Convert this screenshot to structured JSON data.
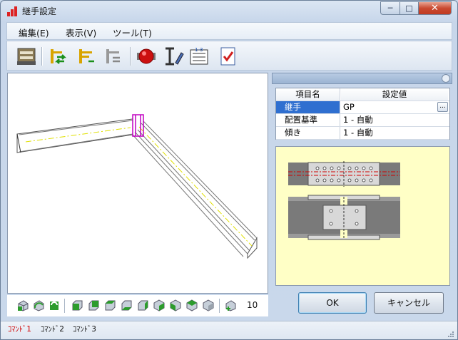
{
  "window": {
    "title": "継手設定"
  },
  "caption_buttons": {
    "minimize": "─",
    "maximize": "□",
    "close": "✕"
  },
  "menu": [
    {
      "label": "編集(E)"
    },
    {
      "label": "表示(V)"
    },
    {
      "label": "ツール(T)"
    }
  ],
  "toolbar_icons": [
    "member-list-icon",
    "swap-green-icon",
    "swap-yellow-icon",
    "swap-gray-icon",
    "red-ball-icon",
    "section-edit-icon",
    "numbered-list-icon",
    "check-document-icon"
  ],
  "view_toolbar": {
    "zoom_value": "10"
  },
  "properties": {
    "headers": {
      "name": "項目名",
      "value": "設定値"
    },
    "rows": [
      {
        "name": "継手",
        "value": "GP",
        "selected": true,
        "has_button": true,
        "button_label": "..."
      },
      {
        "name": "配置基準",
        "value": "1 - 自動"
      },
      {
        "name": "傾き",
        "value": "1 - 自動"
      }
    ]
  },
  "buttons": {
    "ok": "OK",
    "cancel": "キャンセル"
  },
  "status": {
    "cmd1": "ｺﾏﾝﾄﾞ1",
    "cmd2": "ｺﾏﾝﾄﾞ2",
    "cmd3": "ｺﾏﾝﾄﾞ3"
  },
  "colors": {
    "accent_red": "#d00000",
    "selection_blue": "#2f6fd0",
    "preview_bg": "#ffffc6",
    "highlight_magenta": "#c000c0"
  }
}
